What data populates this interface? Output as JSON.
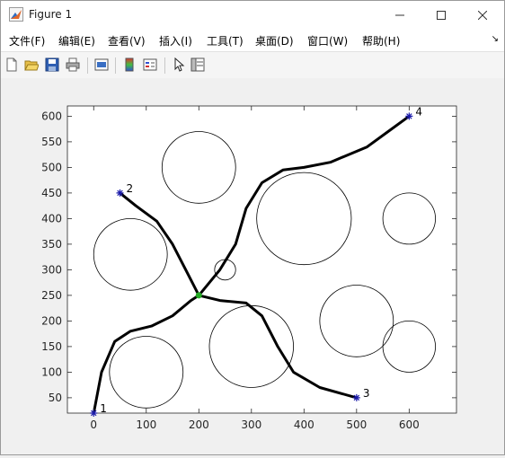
{
  "window": {
    "title": "Figure 1"
  },
  "menu": [
    "文件(F)",
    "编辑(E)",
    "查看(V)",
    "插入(I)",
    "工具(T)",
    "桌面(D)",
    "窗口(W)",
    "帮助(H)"
  ],
  "toolbar_icons": [
    "new-figure-icon",
    "open-file-icon",
    "save-icon",
    "print-icon",
    "link-plot-icon",
    "colorbar-icon",
    "legend-icon",
    "pointer-icon",
    "property-inspector-icon"
  ],
  "chart_data": {
    "type": "scatter",
    "xlim": [
      -50,
      690
    ],
    "ylim": [
      20,
      620
    ],
    "xticks": [
      0,
      100,
      200,
      300,
      400,
      500,
      600
    ],
    "yticks": [
      50,
      100,
      150,
      200,
      250,
      300,
      350,
      400,
      450,
      500,
      550,
      600
    ],
    "obstacles": [
      {
        "cx": 200,
        "cy": 500,
        "r": 70
      },
      {
        "cx": 70,
        "cy": 330,
        "r": 70
      },
      {
        "cx": 100,
        "cy": 100,
        "r": 70
      },
      {
        "cx": 250,
        "cy": 300,
        "r": 20
      },
      {
        "cx": 300,
        "cy": 150,
        "r": 80
      },
      {
        "cx": 400,
        "cy": 400,
        "r": 90
      },
      {
        "cx": 600,
        "cy": 400,
        "r": 50
      },
      {
        "cx": 500,
        "cy": 200,
        "r": 70
      },
      {
        "cx": 600,
        "cy": 150,
        "r": 50
      }
    ],
    "center": {
      "x": 200,
      "y": 250,
      "color": "#22aa22"
    },
    "points": [
      {
        "label": "1",
        "x": 0,
        "y": 20
      },
      {
        "label": "2",
        "x": 50,
        "y": 450
      },
      {
        "label": "3",
        "x": 500,
        "y": 50
      },
      {
        "label": "4",
        "x": 600,
        "y": 600
      }
    ],
    "paths": [
      [
        [
          0,
          20
        ],
        [
          15,
          100
        ],
        [
          40,
          160
        ],
        [
          70,
          180
        ],
        [
          110,
          190
        ],
        [
          150,
          210
        ],
        [
          185,
          240
        ],
        [
          200,
          250
        ]
      ],
      [
        [
          50,
          450
        ],
        [
          80,
          425
        ],
        [
          120,
          395
        ],
        [
          150,
          350
        ],
        [
          180,
          290
        ],
        [
          200,
          250
        ]
      ],
      [
        [
          200,
          250
        ],
        [
          240,
          300
        ],
        [
          270,
          350
        ],
        [
          290,
          420
        ],
        [
          320,
          470
        ],
        [
          360,
          495
        ],
        [
          400,
          500
        ],
        [
          450,
          510
        ],
        [
          520,
          540
        ],
        [
          560,
          570
        ],
        [
          600,
          600
        ]
      ],
      [
        [
          200,
          250
        ],
        [
          240,
          240
        ],
        [
          290,
          235
        ],
        [
          320,
          210
        ],
        [
          350,
          150
        ],
        [
          380,
          100
        ],
        [
          430,
          70
        ],
        [
          500,
          50
        ]
      ]
    ],
    "marker_color": "#1a1aaa"
  }
}
